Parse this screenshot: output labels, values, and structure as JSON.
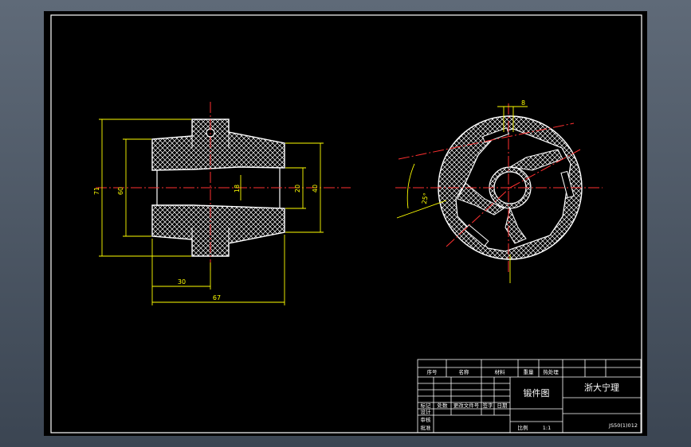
{
  "colors": {
    "background": "#000000",
    "frame": "#ffffff",
    "centerline": "#ff3030",
    "dimension": "#ffff00",
    "outline": "#ffffff"
  },
  "dimensions_left": {
    "overall_height": "71",
    "flange_height": "60",
    "bore_diameter": "18",
    "inner_diameter": "20",
    "end_diameter": "40",
    "half_length": "30",
    "overall_length": "67"
  },
  "dimensions_right": {
    "slot_width": "8",
    "angle": "25°"
  },
  "title_block": {
    "headers": [
      "序号",
      "名称",
      "材料",
      "重量",
      "热处理"
    ],
    "drawing_name": "锻件图",
    "company": "浙大宁理",
    "row_labels": [
      "标记",
      "处数",
      "更改文件号",
      "签字",
      "日期"
    ],
    "left_labels": [
      "设计",
      "审核",
      "批准"
    ],
    "scale_label": "比例",
    "scale_value": "1:1",
    "drawing_number": "JS50(1)012"
  }
}
